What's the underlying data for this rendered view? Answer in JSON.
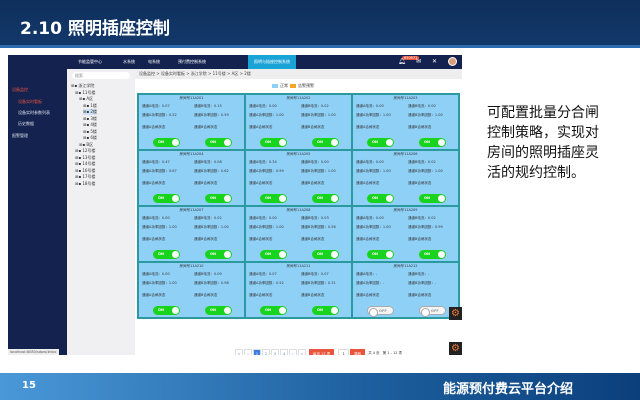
{
  "slide": {
    "title": "2.10 照明插座控制",
    "page_number": "15",
    "footer_title": "能源预付费云平台介绍",
    "note": "可配置批量分合闸控制策略，实现对房间的照明插座灵活的规约控制。"
  },
  "nav": {
    "items": [
      "节能监管中心",
      "水系统",
      "电系统",
      "预付费控制系统",
      "照明与插座控制系统"
    ],
    "active": 4,
    "badge": "650971"
  },
  "sidebar": {
    "items": [
      "设备监控",
      "设备实时看板",
      "设备实时参数列表",
      "历史数据",
      "报警管理"
    ]
  },
  "status_url": "localhost:8080/sdpw/#doc",
  "tree": {
    "search_placeholder": "搜索",
    "nodes": [
      "浙江学院",
      "11号楼",
      "A区",
      "1楼",
      "2楼",
      "3楼",
      "4楼",
      "5楼",
      "6楼",
      "B区",
      "12号楼",
      "13号楼",
      "14号楼",
      "16号楼",
      "17号楼",
      "18号楼"
    ]
  },
  "breadcrumb": "设备监控 > 设备实时看板 > 浙江学院 > 11号楼 > A区 > 2楼",
  "legend": {
    "normal": "正常",
    "alarm": "告警预警",
    "normal_color": "#8fd0f7",
    "alarm_color": "#f5a623"
  },
  "labels": {
    "room": "房间号",
    "a_cur": "通道A电流：",
    "b_cur": "通道B电流：",
    "a_pf": "通道A功率因数：",
    "b_pf": "通道B功率因数：",
    "a_state": "通道A合闸状态",
    "b_state": "通道B合闸状态"
  },
  "cards": [
    {
      "room": "11A201",
      "a": "0.07",
      "b": "0.15",
      "apf": "0.52",
      "bpf": "0.59",
      "sa": "ON",
      "sb": "ON"
    },
    {
      "room": "11A202",
      "a": "0.00",
      "b": "0.02",
      "apf": "1.00",
      "bpf": "1.00",
      "sa": "ON",
      "sb": "ON"
    },
    {
      "room": "11A203",
      "a": "0.00",
      "b": "0.00",
      "apf": "1.00",
      "bpf": "1.00",
      "sa": "ON",
      "sb": "ON"
    },
    {
      "room": "11A204",
      "a": "0.47",
      "b": "0.08",
      "apf": "0.67",
      "bpf": "0.62",
      "sa": "ON",
      "sb": "ON"
    },
    {
      "room": "11A205",
      "a": "0.34",
      "b": "0.00",
      "apf": "0.99",
      "bpf": "1.00",
      "sa": "ON",
      "sb": "ON"
    },
    {
      "room": "11A206",
      "a": "0.00",
      "b": "0.02",
      "apf": "1.00",
      "bpf": "1.00",
      "sa": "ON",
      "sb": "ON"
    },
    {
      "room": "11A207",
      "a": "0.00",
      "b": "0.02",
      "apf": "1.00",
      "bpf": "1.00",
      "sa": "ON",
      "sb": "ON"
    },
    {
      "room": "11A208",
      "a": "0.00",
      "b": "0.03",
      "apf": "1.00",
      "bpf": "0.56",
      "sa": "ON",
      "sb": "ON"
    },
    {
      "room": "11A209",
      "a": "0.00",
      "b": "0.02",
      "apf": "1.00",
      "bpf": "0.99",
      "sa": "ON",
      "sb": "ON"
    },
    {
      "room": "11A210",
      "a": "0.00",
      "b": "0.09",
      "apf": "1.00",
      "bpf": "0.98",
      "sa": "ON",
      "sb": "ON"
    },
    {
      "room": "11A211",
      "a": "0.07",
      "b": "0.07",
      "apf": "0.52",
      "bpf": "0.31",
      "sa": "ON",
      "sb": "ON"
    },
    {
      "room": "11A212",
      "a": "-",
      "b": "-",
      "apf": "-",
      "bpf": "-",
      "sa": "OFF",
      "sb": "OFF"
    }
  ],
  "pager": {
    "first": "«",
    "prev": "‹",
    "pages": [
      "1",
      "2",
      "3",
      "4"
    ],
    "current": "1",
    "next": "›",
    "last": "»",
    "page_size": "每页 12 项",
    "jump_value": "1",
    "jump": "跳转",
    "total_pages": "共 4 页",
    "range": "第 1 - 12 项"
  }
}
